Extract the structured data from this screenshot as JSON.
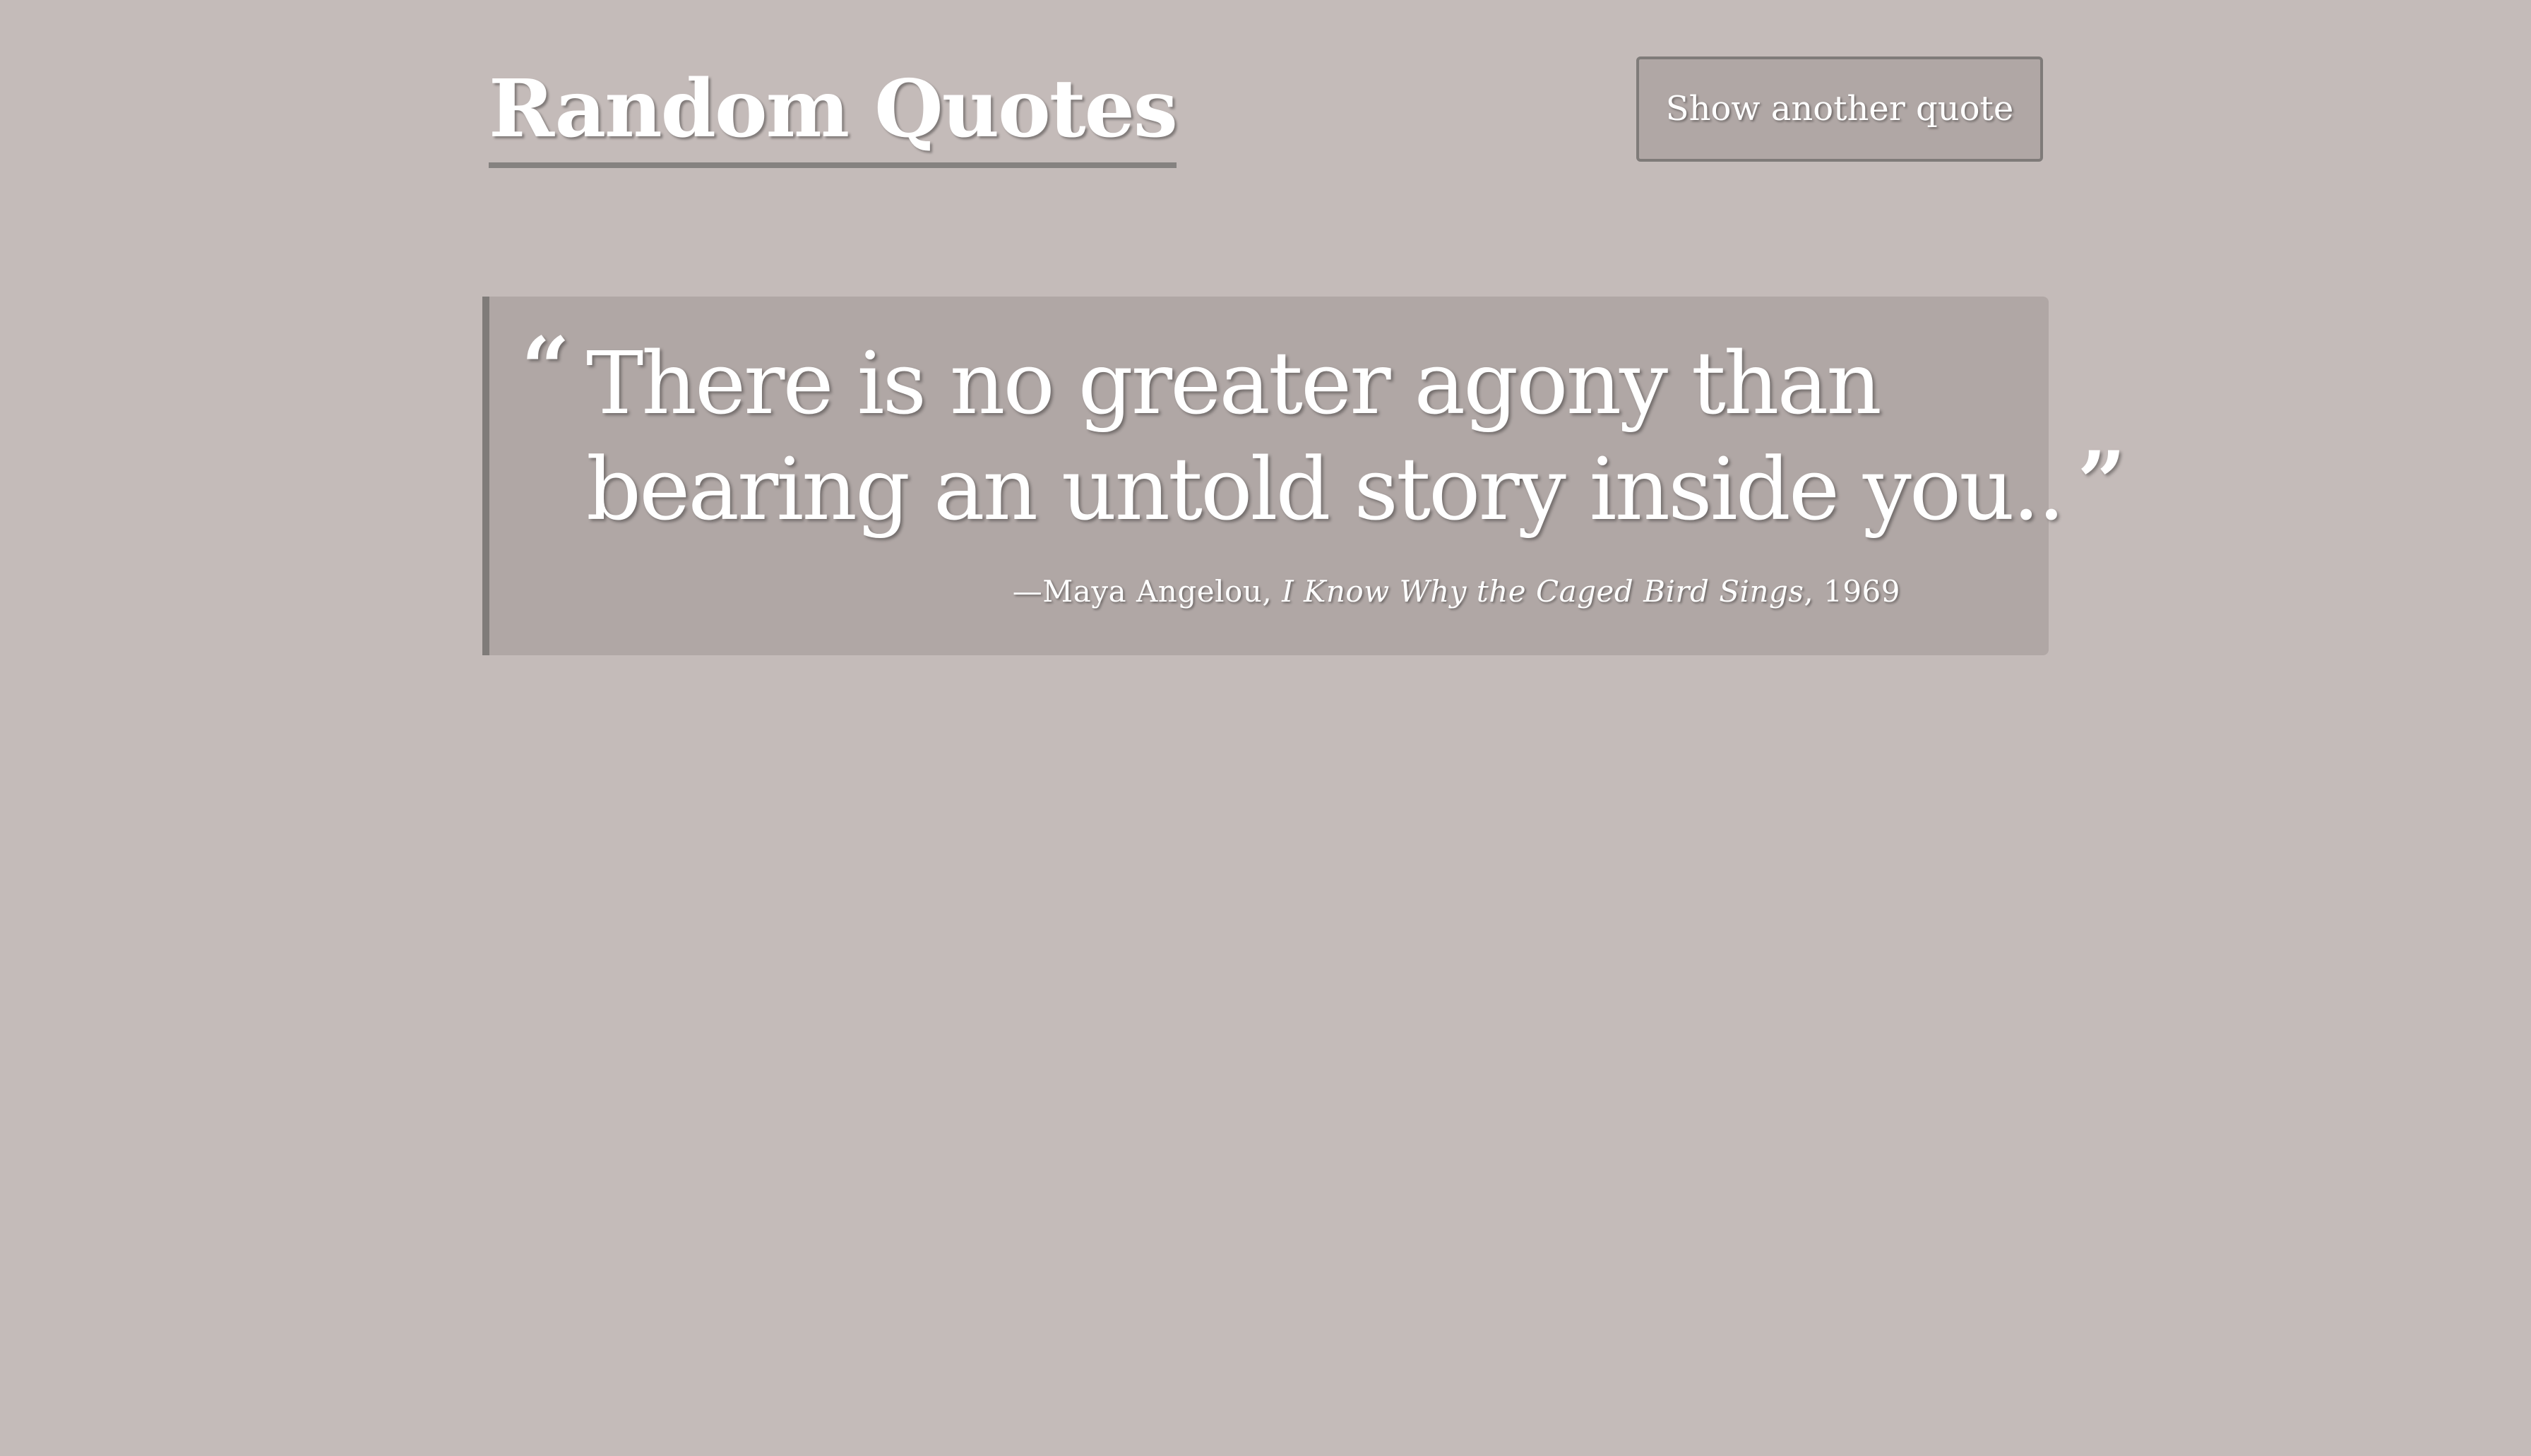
{
  "header": {
    "title": "Random Quotes",
    "button_label": "Show another quote"
  },
  "quote": {
    "open_mark": "“",
    "lines": [
      "There is no greater agony than",
      "bearing an untold story inside you.."
    ],
    "close_mark": "”",
    "attribution": {
      "dash": "—",
      "author": "Maya Angelou,",
      "work": "I Know Why the Caged Bird Sings",
      "year": ", 1969"
    }
  },
  "colors": {
    "background": "#c4bbb9",
    "card": "#b0a7a5",
    "accent_border": "#7f7b79",
    "text": "#ffffff"
  }
}
